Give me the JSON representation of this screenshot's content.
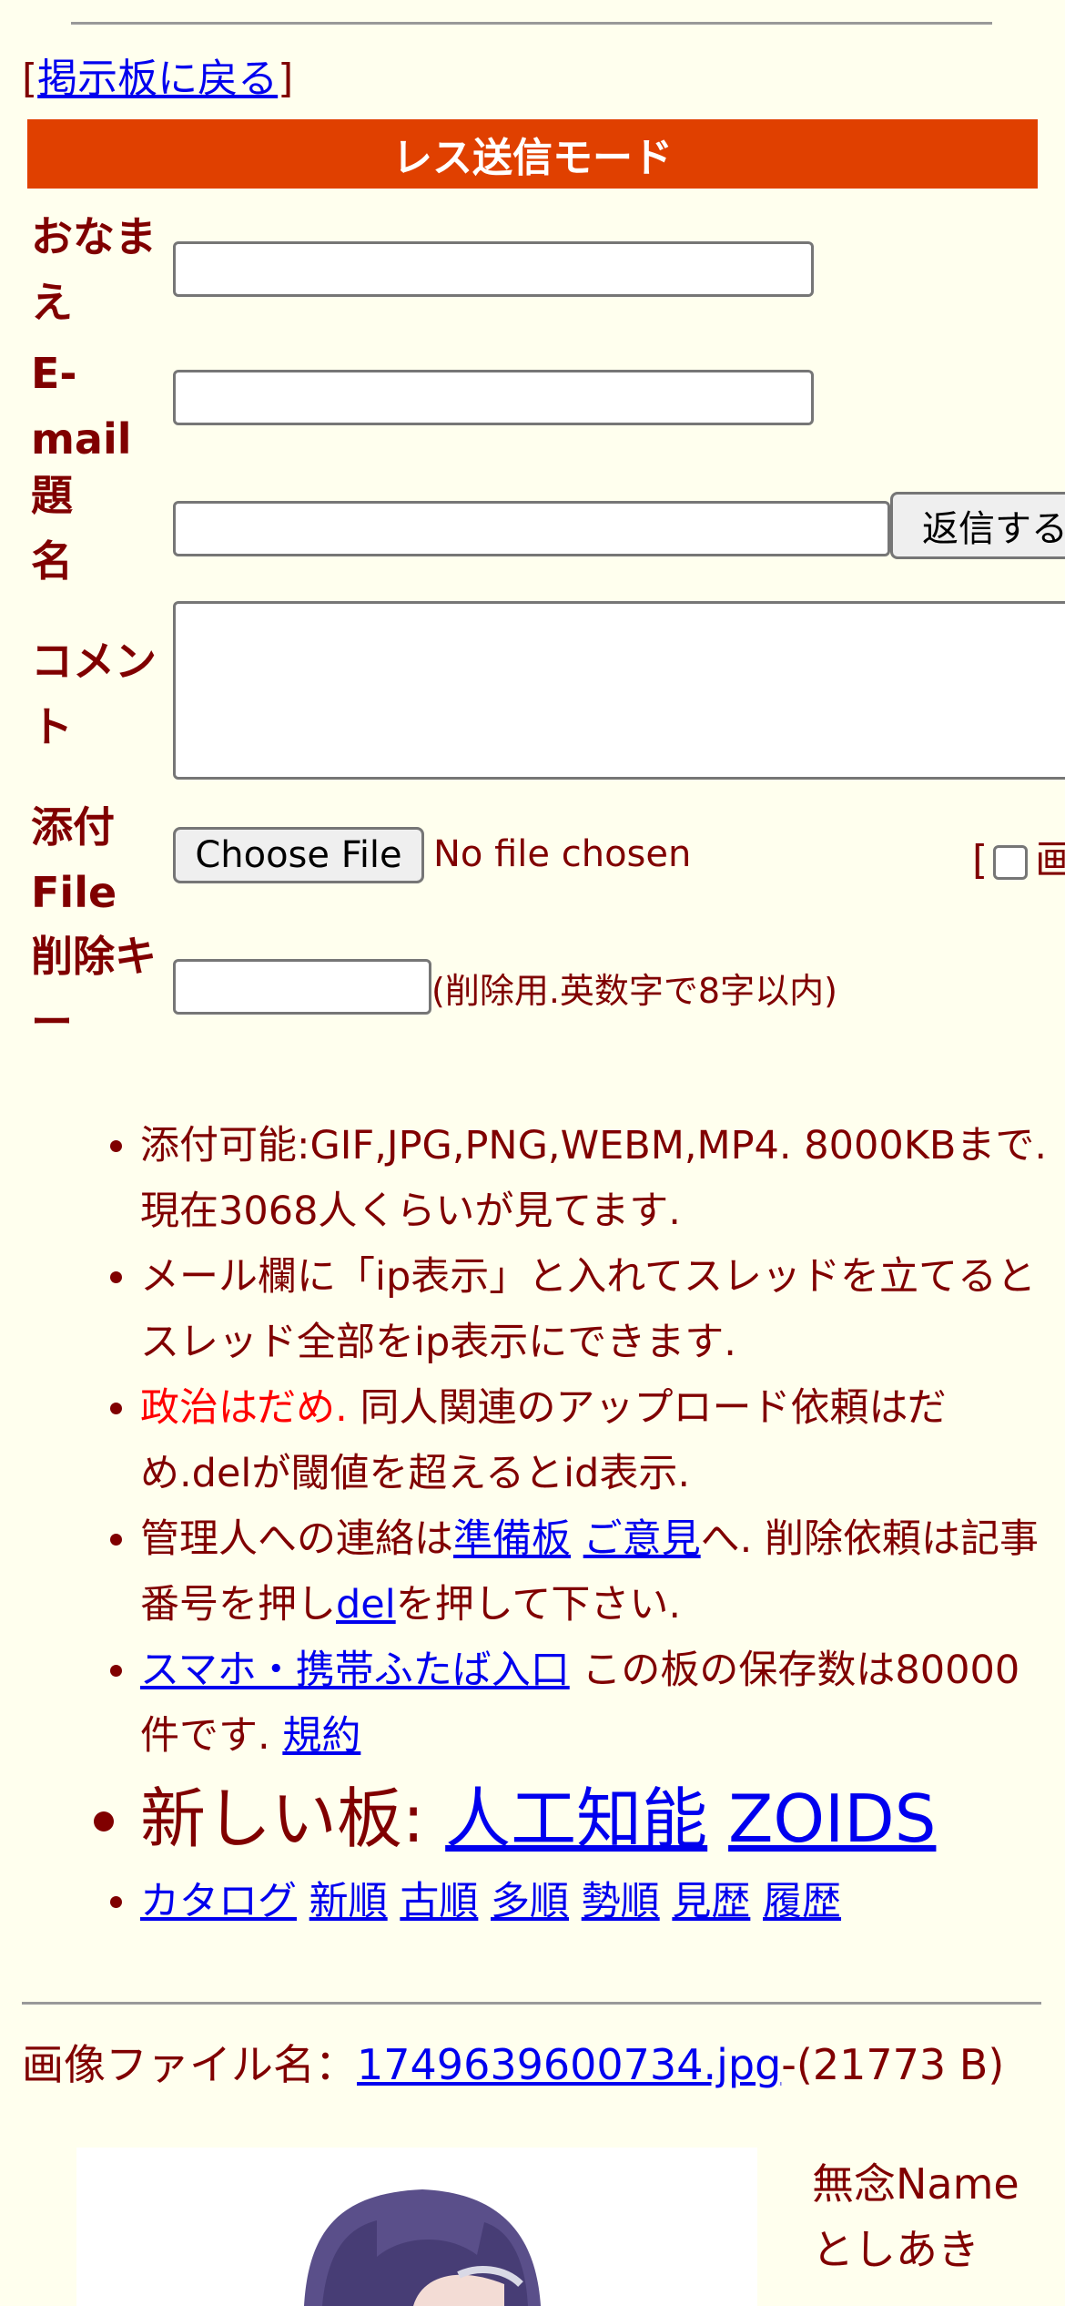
{
  "nav": {
    "open_bracket": "[",
    "return_link": "掲示板に戻る",
    "close_bracket": "]"
  },
  "form": {
    "mode_title": "レス送信モード",
    "name_label": "おなまえ",
    "email_label": "E-mail",
    "subject_label": "題名",
    "submit_label": "返信する",
    "comment_label": "コメント",
    "file_label": "添付File",
    "choose_file_label": "Choose File",
    "no_file_text": "No file chosen",
    "file_extra_text": "[",
    "file_extra_cut": "画",
    "delete_key_label": "削除キー",
    "delete_key_note": "(削除用.英数字で8字以内)"
  },
  "rules": {
    "r1": "添付可能:GIF,JPG,PNG,WEBM,MP4. 8000KBまで. 現在3068人くらいが見てます.",
    "r2": "メール欄に「ip表示」と入れてスレッドを立てるとスレッド全部をip表示にできます.",
    "r3_red": "政治はだめ.",
    "r3_rest": " 同人関連のアップロード依頼はだめ.delが閾値を超えるとid表示.",
    "r4_a": "管理人への連絡は",
    "r4_link1": "準備板",
    "r4_sp": " ",
    "r4_link2": "ご意見",
    "r4_b": "へ. 削除依頼は記事番号を押し",
    "r4_link3": "del",
    "r4_c": "を押して下さい.",
    "r5_link": "スマホ・携帯ふたば入口",
    "r5_a": " この板の保存数は80000件です. ",
    "r5_link2": "規約",
    "new_boards_label": "新しい板: ",
    "new_board_1": "人工知能",
    "new_board_2": "ZOIDS",
    "sort_links": [
      "カタログ",
      "新順",
      "古順",
      "多順",
      "勢順",
      "見歴",
      "履歴"
    ]
  },
  "post": {
    "file_label": "画像ファイル名：",
    "file_name": "1749639600734.jpg",
    "file_size": "-(21773 B)",
    "subject": "無念",
    "name_label": "Name",
    "name": "としあき"
  },
  "colors": {
    "background": "#ffffee",
    "text": "#800000",
    "mode_bar": "#e04000",
    "link": "#0000ee",
    "warning": "#ff0000"
  }
}
